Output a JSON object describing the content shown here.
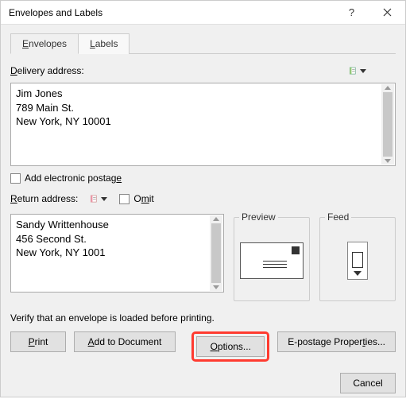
{
  "window": {
    "title": "Envelopes and Labels"
  },
  "tabs": {
    "envelopes": "Envelopes",
    "labels": "Labels"
  },
  "delivery": {
    "label": "Delivery address:",
    "value": "Jim Jones\n789 Main St.\nNew York, NY 10001"
  },
  "electronic_postage": {
    "label": "Add electronic postage"
  },
  "return": {
    "label": "Return address:",
    "omit_label": "Omit",
    "value": "Sandy Writtenhouse\n456 Second St.\nNew York, NY 1001"
  },
  "preview": {
    "legend": "Preview"
  },
  "feed": {
    "legend": "Feed"
  },
  "verify_text": "Verify that an envelope is loaded before printing.",
  "buttons": {
    "print": "Print",
    "add_to_document": "Add to Document",
    "options": "Options...",
    "e_postage": "E-postage Properties...",
    "cancel": "Cancel"
  }
}
